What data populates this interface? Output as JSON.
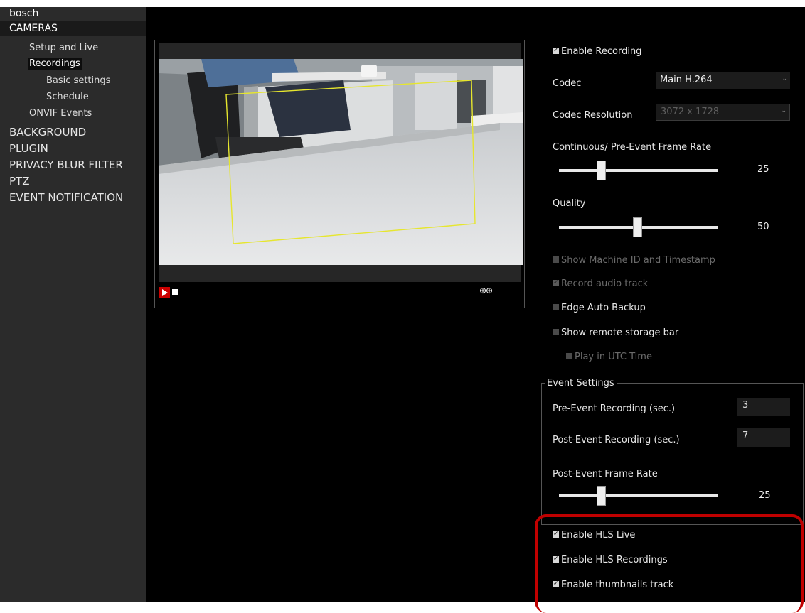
{
  "sidebar": {
    "brand": "bosch",
    "section": "CAMERAS",
    "items": [
      {
        "label": "Setup and Live"
      },
      {
        "label": "Recordings"
      },
      {
        "label": "Basic settings"
      },
      {
        "label": "Schedule"
      },
      {
        "label": "ONVIF Events"
      }
    ],
    "top_items": [
      "BACKGROUND",
      "PLUGIN",
      "PRIVACY BLUR FILTER",
      "PTZ",
      "EVENT NOTIFICATION"
    ]
  },
  "video": {
    "play_icon": "play-icon",
    "stop_icon": "stop-icon",
    "zoom_icons": "⊕⊕",
    "overlay_color": "#e6e62e"
  },
  "settings": {
    "enable_recording": {
      "label": "Enable Recording",
      "checked": true
    },
    "codec": {
      "label": "Codec",
      "value": "Main H.264"
    },
    "codec_resolution": {
      "label": "Codec Resolution",
      "value": "3072 x 1728"
    },
    "frame_rate": {
      "label": "Continuous/ Pre-Event Frame Rate",
      "value": "25"
    },
    "quality": {
      "label": "Quality",
      "value": "50"
    },
    "show_machine_id": {
      "label": "Show Machine ID and Timestamp",
      "checked": false
    },
    "record_audio": {
      "label": "Record audio track",
      "checked": true
    },
    "edge_auto_backup": {
      "label": "Edge Auto Backup",
      "checked": false
    },
    "show_remote_storage": {
      "label": "Show remote storage bar",
      "checked": false
    },
    "play_utc": {
      "label": "Play in UTC Time",
      "checked": false
    }
  },
  "event_settings": {
    "legend": "Event Settings",
    "pre_event": {
      "label": "Pre-Event Recording (sec.)",
      "value": "3"
    },
    "post_event": {
      "label": "Post-Event Recording (sec.)",
      "value": "7"
    },
    "post_event_frame_rate": {
      "label": "Post-Event Frame Rate",
      "value": "25"
    }
  },
  "hls": {
    "live": {
      "label": "Enable HLS Live",
      "checked": true
    },
    "recordings": {
      "label": "Enable HLS Recordings",
      "checked": true
    },
    "thumbnails": {
      "label": "Enable thumbnails track",
      "checked": true
    }
  },
  "colors": {
    "highlight": "#c00000",
    "sidebar_bg": "#2b2b2b",
    "background": "#000000"
  }
}
